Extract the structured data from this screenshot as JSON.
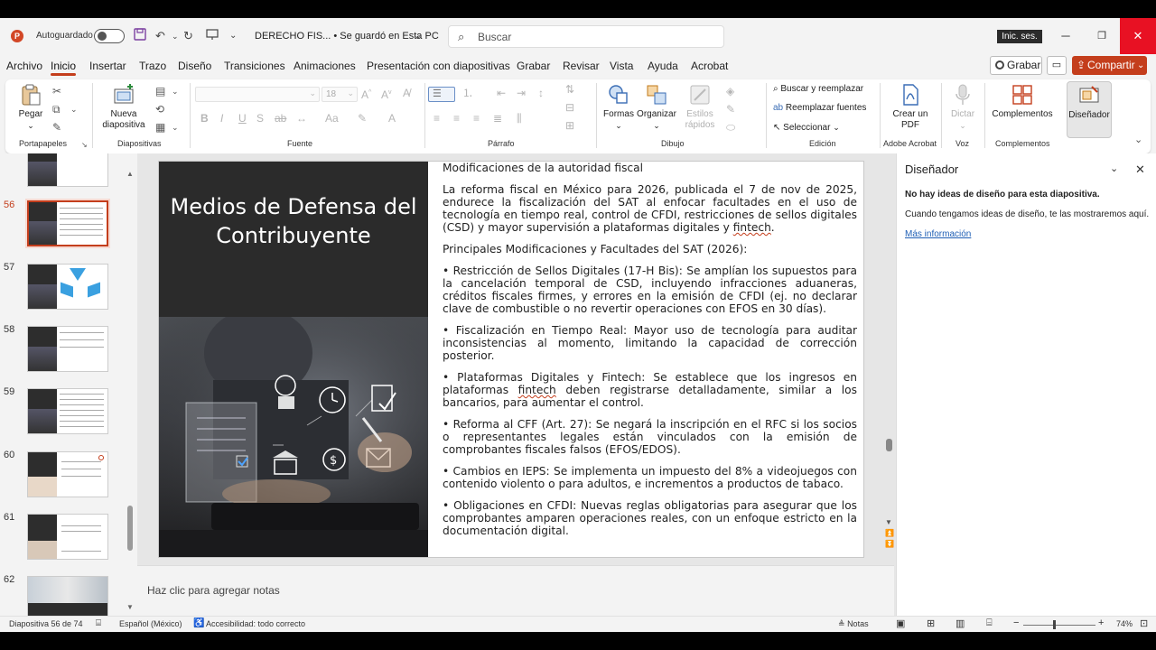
{
  "titlebar": {
    "app_logo": "P",
    "autosave_label": "Autoguardado",
    "doc_name": "DERECHO FIS... • Se guardó en Esta PC",
    "search_placeholder": "Buscar",
    "signin_label": "Inic. ses."
  },
  "tabs": [
    "Archivo",
    "Inicio",
    "Insertar",
    "Trazo",
    "Diseño",
    "Transiciones",
    "Animaciones",
    "Presentación con diapositivas",
    "Grabar",
    "Revisar",
    "Vista",
    "Ayuda",
    "Acrobat"
  ],
  "actions": {
    "record_label": "Grabar",
    "share_label": "Compartir"
  },
  "ribbon": {
    "paste_label": "Pegar",
    "new_slide_label": "Nueva diapositiva",
    "font_size_value": "18",
    "shapes_label": "Formas",
    "arrange_label": "Organizar",
    "quick_styles_label": "Estilos rápidos",
    "find_replace_label": "Buscar y reemplazar",
    "replace_fonts_label": "Reemplazar fuentes",
    "select_label": "Seleccionar",
    "create_pdf_label": "Crear un PDF",
    "dictate_label": "Dictar",
    "addins_label": "Complementos",
    "designer_label": "Diseñador",
    "groups": {
      "clipboard": "Portapapeles",
      "slides": "Diapositivas",
      "font": "Fuente",
      "paragraph": "Párrafo",
      "drawing": "Dibujo",
      "editing": "Edición",
      "acrobat": "Adobe Acrobat",
      "voice": "Voz",
      "addins": "Complementos"
    }
  },
  "thumbnails": [
    {
      "num": "56",
      "active": true
    },
    {
      "num": "57",
      "active": false
    },
    {
      "num": "58",
      "active": false
    },
    {
      "num": "59",
      "active": false
    },
    {
      "num": "60",
      "active": false
    },
    {
      "num": "61",
      "active": false
    },
    {
      "num": "62",
      "active": false
    }
  ],
  "slide": {
    "title": "Medios de Defensa del Contribuyente",
    "heading": "Modificaciones de la autoridad fiscal",
    "intro_a": "La reforma fiscal en México para 2026, publicada el 7 de nov de 2025, endurece la fiscalización del SAT al enfocar facultades en el uso de tecnología en tiempo real, control de CFDI, restricciones de sellos digitales (CSD) y mayor supervisión a plataformas digitales y ",
    "intro_fintech": "fintech",
    "intro_end": ".",
    "subheading": "Principales Modificaciones y Facultades del SAT (2026):",
    "b1": "• Restricción de Sellos Digitales (17-H Bis): Se amplían los supuestos para la cancelación temporal de CSD, incluyendo infracciones aduaneras, créditos fiscales firmes, y errores en la emisión de CFDI (ej. no declarar clave de combustible o no revertir operaciones con EFOS en 30 días).",
    "b2": "• Fiscalización en Tiempo Real: Mayor uso de tecnología para auditar inconsistencias al momento, limitando la capacidad de corrección posterior.",
    "b3_a": "• Plataformas Digitales y Fintech: Se establece que los ingresos en plataformas ",
    "b3_fintech": "fintech",
    "b3_b": " deben registrarse detalladamente, similar a los bancarios, para aumentar el control.",
    "b4": "• Reforma al CFF (Art. 27): Se negará la inscripción en el RFC si los socios o representantes legales están vinculados con la emisión de comprobantes fiscales falsos (EFOS/EDOS).",
    "b5": "• Cambios en IEPS: Se implementa un impuesto del 8% a videojuegos con contenido violento o para adultos, e incrementos a productos de tabaco.",
    "b6": "• Obligaciones en CFDI: Nuevas reglas obligatorias para asegurar que los comprobantes amparen operaciones reales, con un enfoque estricto en la documentación digital."
  },
  "notes_placeholder": "Haz clic para agregar notas",
  "designer": {
    "title": "Diseñador",
    "no_ideas": "No hay ideas de diseño para esta diapositiva.",
    "message": "Cuando tengamos ideas de diseño, te las mostraremos aquí.",
    "more_info": "Más información"
  },
  "status": {
    "slide_counter": "Diapositiva 56 de 74",
    "language": "Español (México)",
    "accessibility": "Accesibilidad: todo correcto",
    "notes_label": "Notas",
    "zoom": "74%",
    "zoom_fraction": 0.42
  },
  "colors": {
    "accent": "#c43e1c",
    "close": "#e81123",
    "link": "#1f5fb5"
  }
}
